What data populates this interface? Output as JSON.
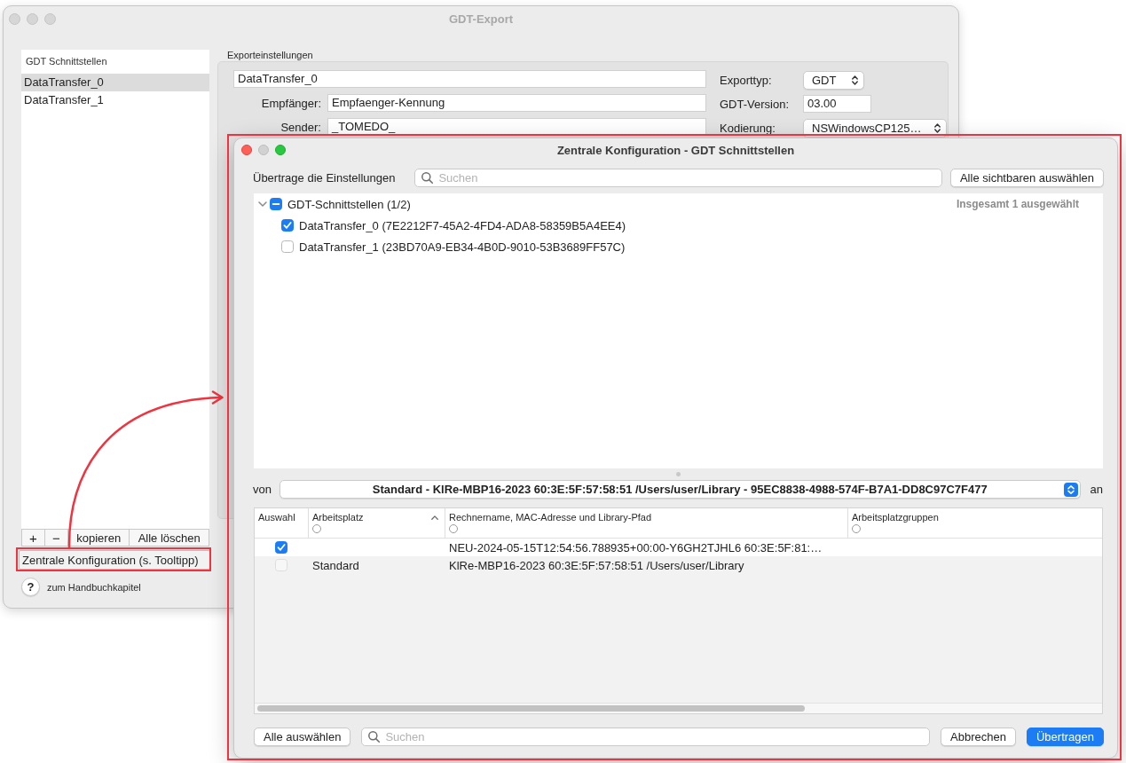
{
  "back_window": {
    "title": "GDT-Export",
    "active": false,
    "list": {
      "header": "GDT Schnittstellen",
      "items": [
        {
          "label": "DataTransfer_0",
          "selected": true
        },
        {
          "label": "DataTransfer_1",
          "selected": false
        }
      ]
    },
    "list_buttons": [
      {
        "kind": "icon",
        "label": "+"
      },
      {
        "kind": "icon",
        "label": "−"
      },
      {
        "kind": "text",
        "label": "kopieren"
      },
      {
        "kind": "text",
        "label": "Alle löschen"
      }
    ],
    "central_button": {
      "label": "Zentrale Konfiguration (s. Tooltipp)",
      "highlighted": true
    },
    "help": {
      "button": "?",
      "label": "zum Handbuchkapitel"
    },
    "export_settings": {
      "title": "Exporteinstellungen",
      "name": "DataTransfer_0",
      "fields": [
        {
          "label": "Empfänger:",
          "value": "Empfaenger-Kennung"
        },
        {
          "label": "Sender:",
          "value": "_TOMEDO_"
        }
      ],
      "options": [
        {
          "kind": "popup",
          "label": "Exporttyp:",
          "value": "GDT"
        },
        {
          "kind": "field",
          "label": "GDT-Version:",
          "value": "03.00"
        },
        {
          "kind": "popup",
          "label": "Kodierung:",
          "value": "NSWindowsCP125…"
        }
      ]
    }
  },
  "dialog": {
    "title": "Zentrale Konfiguration - GDT Schnittstellen",
    "active": true,
    "highlighted": true,
    "controls": [
      {
        "kind": "close",
        "enabled": true
      },
      {
        "kind": "minimize",
        "enabled": false
      },
      {
        "kind": "zoom",
        "enabled": true
      }
    ],
    "transfer_label": "Übertrage die Einstellungen",
    "search": {
      "placeholder": "Suchen"
    },
    "select_visible_button": "Alle sichtbaren auswählen",
    "tree": {
      "summary": "Insgesamt 1 ausgewählt",
      "items": [
        {
          "label": "GDT-Schnittstellen (1/2)",
          "mixed": true,
          "expanded": true,
          "children": [
            {
              "label": "DataTransfer_0 (7E2212F7-45A2-4FD4-ADA8-58359B5A4EE4)",
              "checked": true
            },
            {
              "label": "DataTransfer_1 (23BD70A9-EB34-4B0D-9010-53B3689FF57C)",
              "checked": false
            }
          ]
        }
      ]
    },
    "source": {
      "label": "von",
      "value": "Standard - KlRe-MBP16-2023 60:3E:5F:57:58:51 /Users/user/Library - 95EC8838-4988-574F-B7A1-DD8C97C7F477",
      "target_label": "an"
    },
    "table": {
      "columns": [
        {
          "label": "Auswahl",
          "sorted": false,
          "filter": false
        },
        {
          "label": "Arbeitsplatz",
          "sorted": true,
          "filter": true
        },
        {
          "label": "Rechnername, MAC-Adresse und Library-Pfad",
          "sorted": false,
          "filter": true
        },
        {
          "label": "Arbeitsplatzgruppen",
          "sorted": false,
          "filter": true
        }
      ],
      "rows": [
        {
          "checked": true,
          "disabled": false,
          "computer": "NEU-2024-05-15T12:54:56.788935+00:00-Y6GH2TJHL6 60:3E:5F:81:…"
        },
        {
          "checked": false,
          "disabled": true,
          "workplace": "Standard",
          "computer": "KlRe-MBP16-2023 60:3E:5F:57:58:51 /Users/user/Library"
        }
      ]
    },
    "footer": {
      "select_all_button": "Alle auswählen",
      "search": {
        "placeholder": "Suchen"
      },
      "buttons": [
        {
          "label": "Abbrechen",
          "default": false
        },
        {
          "label": "Übertragen",
          "default": true
        }
      ]
    }
  }
}
